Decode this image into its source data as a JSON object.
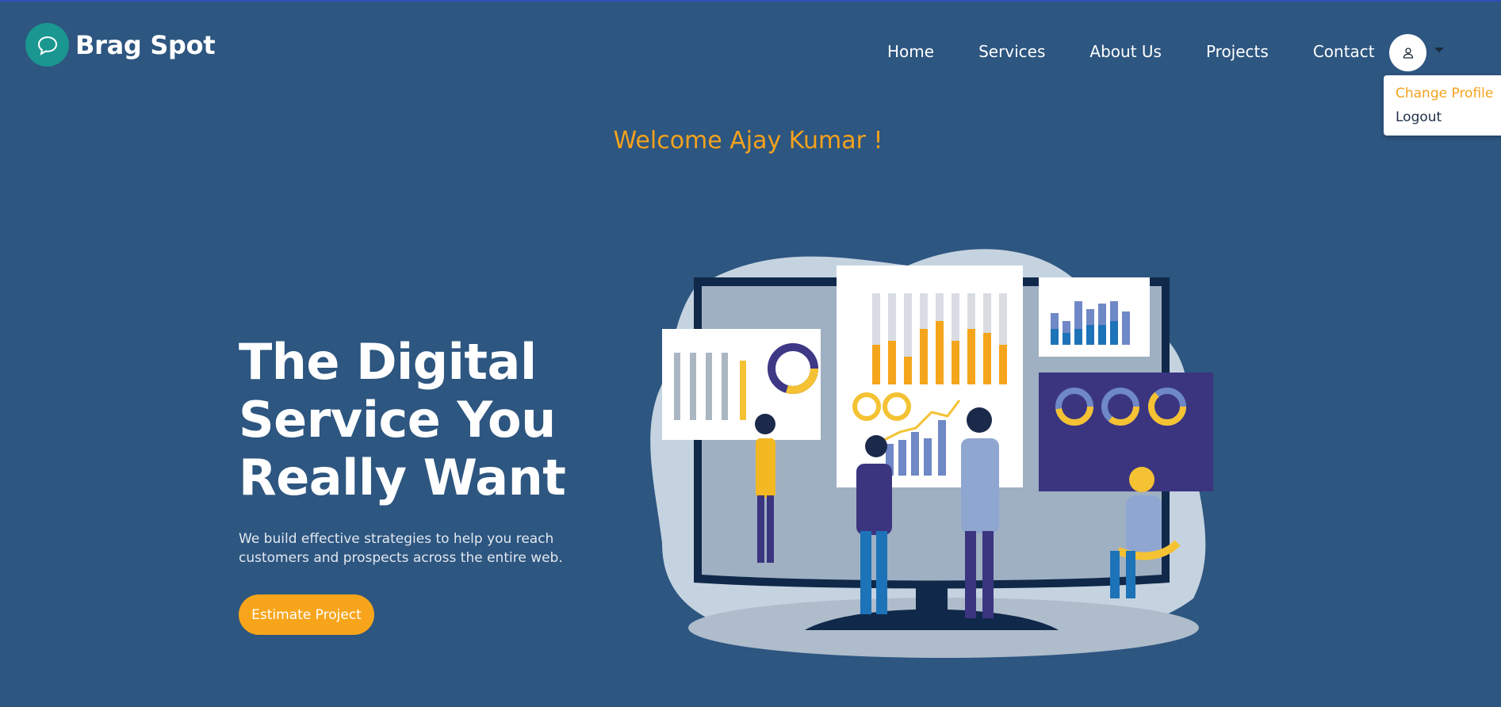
{
  "brand": {
    "name": "Brag Spot",
    "logo_icon": "chat-bubble-icon",
    "logo_color": "#1a9790"
  },
  "nav": {
    "items": [
      {
        "label": "Home"
      },
      {
        "label": "Services"
      },
      {
        "label": "About Us"
      },
      {
        "label": "Projects"
      },
      {
        "label": "Contact"
      }
    ]
  },
  "user_menu": {
    "avatar_icon": "user-icon",
    "caret_icon": "caret-down-icon",
    "items": [
      {
        "label": "Change Profile",
        "color": "#f3a21d"
      },
      {
        "label": "Logout",
        "color": "#1e2e48"
      }
    ]
  },
  "welcome": "Welcome Ajay Kumar !",
  "hero": {
    "title_line1": "The Digital",
    "title_line2": "Service You",
    "title_line3": "Really Want",
    "subtitle": "We build effective strategies to help you reach customers and prospects across the entire web.",
    "cta_label": "Estimate Project"
  },
  "colors": {
    "background": "#2d5680",
    "accent": "#f3a21d",
    "button": "#f8a51b"
  }
}
